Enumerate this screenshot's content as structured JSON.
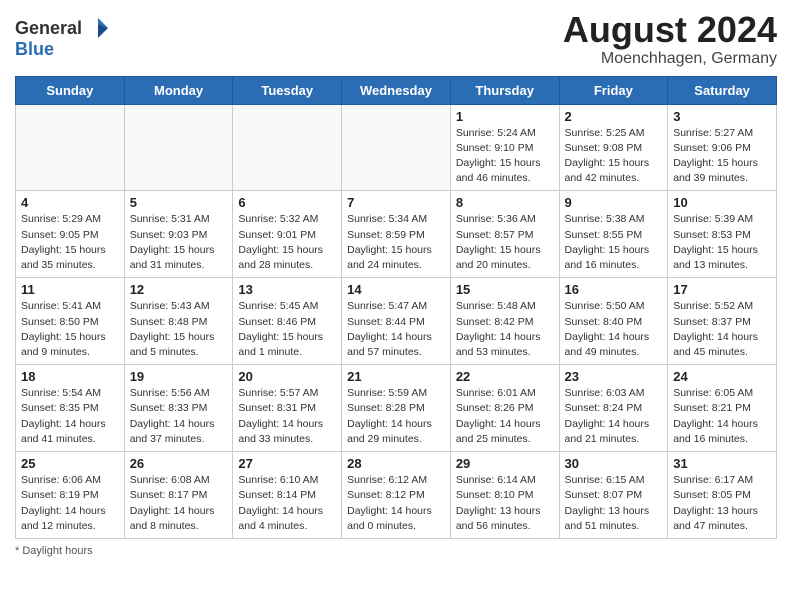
{
  "header": {
    "logo_general": "General",
    "logo_blue": "Blue",
    "month_year": "August 2024",
    "location": "Moenchhagen, Germany"
  },
  "days_of_week": [
    "Sunday",
    "Monday",
    "Tuesday",
    "Wednesday",
    "Thursday",
    "Friday",
    "Saturday"
  ],
  "weeks": [
    [
      {
        "day": "",
        "info": ""
      },
      {
        "day": "",
        "info": ""
      },
      {
        "day": "",
        "info": ""
      },
      {
        "day": "",
        "info": ""
      },
      {
        "day": "1",
        "info": "Sunrise: 5:24 AM\nSunset: 9:10 PM\nDaylight: 15 hours\nand 46 minutes."
      },
      {
        "day": "2",
        "info": "Sunrise: 5:25 AM\nSunset: 9:08 PM\nDaylight: 15 hours\nand 42 minutes."
      },
      {
        "day": "3",
        "info": "Sunrise: 5:27 AM\nSunset: 9:06 PM\nDaylight: 15 hours\nand 39 minutes."
      }
    ],
    [
      {
        "day": "4",
        "info": "Sunrise: 5:29 AM\nSunset: 9:05 PM\nDaylight: 15 hours\nand 35 minutes."
      },
      {
        "day": "5",
        "info": "Sunrise: 5:31 AM\nSunset: 9:03 PM\nDaylight: 15 hours\nand 31 minutes."
      },
      {
        "day": "6",
        "info": "Sunrise: 5:32 AM\nSunset: 9:01 PM\nDaylight: 15 hours\nand 28 minutes."
      },
      {
        "day": "7",
        "info": "Sunrise: 5:34 AM\nSunset: 8:59 PM\nDaylight: 15 hours\nand 24 minutes."
      },
      {
        "day": "8",
        "info": "Sunrise: 5:36 AM\nSunset: 8:57 PM\nDaylight: 15 hours\nand 20 minutes."
      },
      {
        "day": "9",
        "info": "Sunrise: 5:38 AM\nSunset: 8:55 PM\nDaylight: 15 hours\nand 16 minutes."
      },
      {
        "day": "10",
        "info": "Sunrise: 5:39 AM\nSunset: 8:53 PM\nDaylight: 15 hours\nand 13 minutes."
      }
    ],
    [
      {
        "day": "11",
        "info": "Sunrise: 5:41 AM\nSunset: 8:50 PM\nDaylight: 15 hours\nand 9 minutes."
      },
      {
        "day": "12",
        "info": "Sunrise: 5:43 AM\nSunset: 8:48 PM\nDaylight: 15 hours\nand 5 minutes."
      },
      {
        "day": "13",
        "info": "Sunrise: 5:45 AM\nSunset: 8:46 PM\nDaylight: 15 hours\nand 1 minute."
      },
      {
        "day": "14",
        "info": "Sunrise: 5:47 AM\nSunset: 8:44 PM\nDaylight: 14 hours\nand 57 minutes."
      },
      {
        "day": "15",
        "info": "Sunrise: 5:48 AM\nSunset: 8:42 PM\nDaylight: 14 hours\nand 53 minutes."
      },
      {
        "day": "16",
        "info": "Sunrise: 5:50 AM\nSunset: 8:40 PM\nDaylight: 14 hours\nand 49 minutes."
      },
      {
        "day": "17",
        "info": "Sunrise: 5:52 AM\nSunset: 8:37 PM\nDaylight: 14 hours\nand 45 minutes."
      }
    ],
    [
      {
        "day": "18",
        "info": "Sunrise: 5:54 AM\nSunset: 8:35 PM\nDaylight: 14 hours\nand 41 minutes."
      },
      {
        "day": "19",
        "info": "Sunrise: 5:56 AM\nSunset: 8:33 PM\nDaylight: 14 hours\nand 37 minutes."
      },
      {
        "day": "20",
        "info": "Sunrise: 5:57 AM\nSunset: 8:31 PM\nDaylight: 14 hours\nand 33 minutes."
      },
      {
        "day": "21",
        "info": "Sunrise: 5:59 AM\nSunset: 8:28 PM\nDaylight: 14 hours\nand 29 minutes."
      },
      {
        "day": "22",
        "info": "Sunrise: 6:01 AM\nSunset: 8:26 PM\nDaylight: 14 hours\nand 25 minutes."
      },
      {
        "day": "23",
        "info": "Sunrise: 6:03 AM\nSunset: 8:24 PM\nDaylight: 14 hours\nand 21 minutes."
      },
      {
        "day": "24",
        "info": "Sunrise: 6:05 AM\nSunset: 8:21 PM\nDaylight: 14 hours\nand 16 minutes."
      }
    ],
    [
      {
        "day": "25",
        "info": "Sunrise: 6:06 AM\nSunset: 8:19 PM\nDaylight: 14 hours\nand 12 minutes."
      },
      {
        "day": "26",
        "info": "Sunrise: 6:08 AM\nSunset: 8:17 PM\nDaylight: 14 hours\nand 8 minutes."
      },
      {
        "day": "27",
        "info": "Sunrise: 6:10 AM\nSunset: 8:14 PM\nDaylight: 14 hours\nand 4 minutes."
      },
      {
        "day": "28",
        "info": "Sunrise: 6:12 AM\nSunset: 8:12 PM\nDaylight: 14 hours\nand 0 minutes."
      },
      {
        "day": "29",
        "info": "Sunrise: 6:14 AM\nSunset: 8:10 PM\nDaylight: 13 hours\nand 56 minutes."
      },
      {
        "day": "30",
        "info": "Sunrise: 6:15 AM\nSunset: 8:07 PM\nDaylight: 13 hours\nand 51 minutes."
      },
      {
        "day": "31",
        "info": "Sunrise: 6:17 AM\nSunset: 8:05 PM\nDaylight: 13 hours\nand 47 minutes."
      }
    ]
  ],
  "footer": {
    "note": "Daylight hours"
  }
}
